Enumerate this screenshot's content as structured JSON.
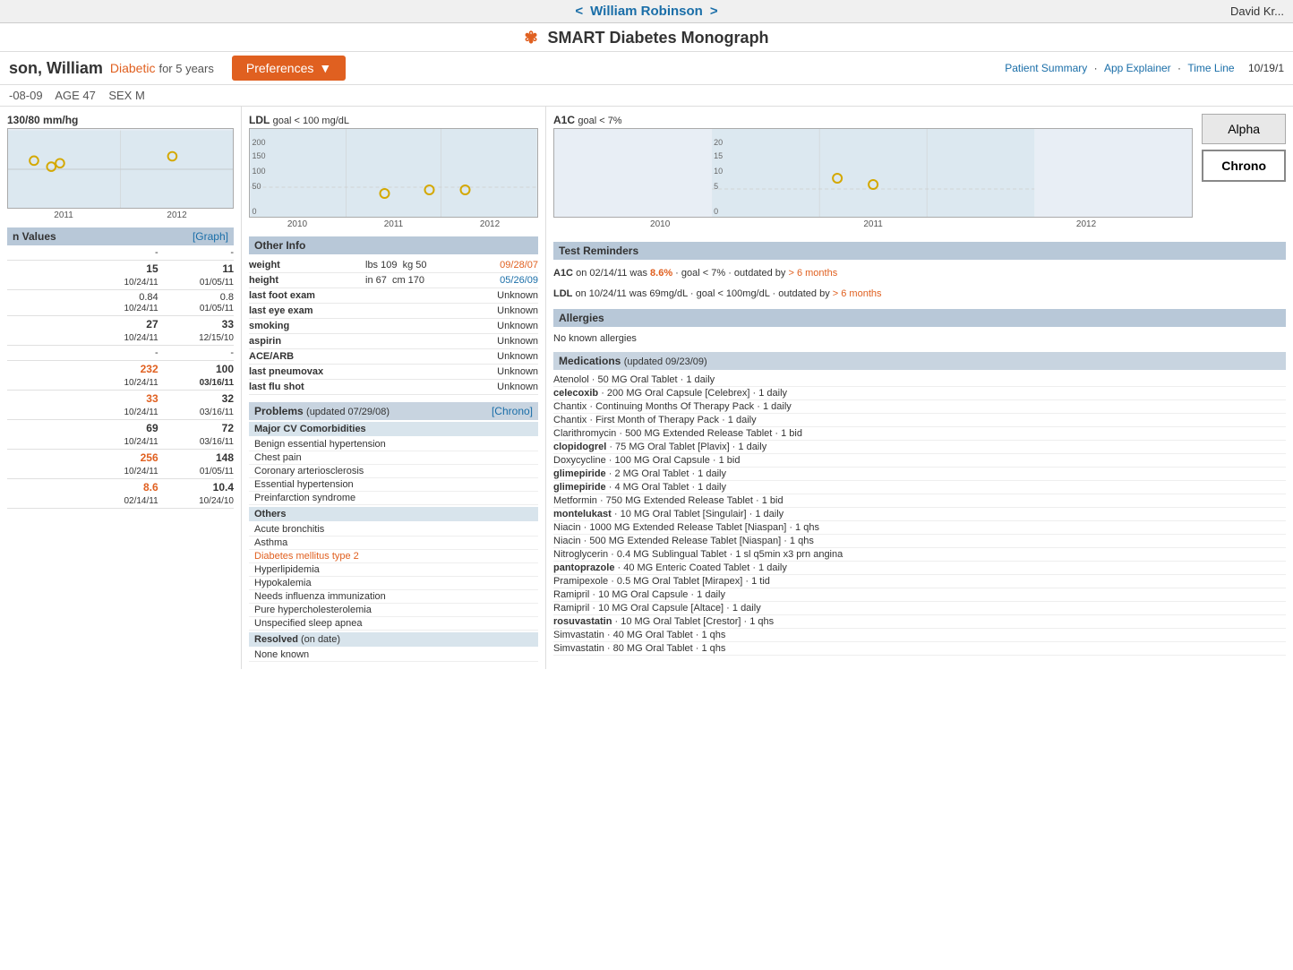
{
  "nav": {
    "prev": "<",
    "next": ">",
    "patient_name": "William Robinson",
    "current_user": "David Kr..."
  },
  "title": "SMART Diabetes Monograph",
  "header": {
    "patient_last": "son, William",
    "diabetic_label": "Diabetic",
    "for_years": "for 5 years",
    "pref_button": "Preferences",
    "patient_summary": "Patient Summary",
    "app_explainer": "App Explainer",
    "time_line": "Time Line",
    "date": "10/19/1"
  },
  "demo": {
    "dob": "-08-09",
    "age_label": "AGE",
    "age": "47",
    "sex_label": "SEX",
    "sex": "M"
  },
  "bp_chart": {
    "title": "130/80 mm/hg",
    "years": [
      "2011",
      "2012"
    ]
  },
  "ldl_chart": {
    "title": "LDL",
    "goal": "goal < 100 mg/dL",
    "y_labels": [
      "200",
      "150",
      "100",
      "50",
      "0"
    ],
    "x_labels": [
      "2010",
      "2011",
      "2012"
    ]
  },
  "a1c_chart": {
    "title": "A1C",
    "goal": "goal < 7%",
    "y_labels": [
      "20",
      "15",
      "10",
      "5",
      "0"
    ],
    "x_labels": [
      "2010",
      "2011",
      "2012"
    ]
  },
  "view_buttons": {
    "alpha": "Alpha",
    "chrono": "Chrono"
  },
  "lab_values": {
    "header": "n Values",
    "graph_link": "[Graph]",
    "rows": [
      {
        "label": "",
        "v1": "-",
        "v2": "-",
        "d1": "",
        "d2": ""
      },
      {
        "label": "",
        "v1": "15",
        "v2": "11",
        "d1": "10/24/11",
        "d2": "01/05/11",
        "bold": true
      },
      {
        "label": "",
        "v1": "0.84",
        "v2": "0.8",
        "d1": "10/24/11",
        "d2": "01/05/11"
      },
      {
        "label": "",
        "v1": "27",
        "v2": "33",
        "d1": "10/24/11",
        "d2": "12/15/10",
        "bold": true
      },
      {
        "label": "",
        "v1": "-",
        "v2": "-",
        "d1": "",
        "d2": ""
      },
      {
        "label": "",
        "v1": "232",
        "v2": "100",
        "d1": "10/24/11",
        "d2": "03/16/11",
        "bold": true,
        "color1": "orange"
      },
      {
        "label": "",
        "v1": "33",
        "v2": "32",
        "d1": "10/24/11",
        "d2": "03/16/11",
        "bold": true,
        "color1": "orange",
        "color2": "orange"
      },
      {
        "label": "",
        "v1": "69",
        "v2": "72",
        "d1": "10/24/11",
        "d2": "03/16/11",
        "bold": true
      },
      {
        "label": "",
        "v1": "256",
        "v2": "148",
        "d1": "10/24/11",
        "d2": "01/05/11",
        "bold": true,
        "color1": "orange",
        "color2": "orange"
      },
      {
        "label": "",
        "v1": "8.6",
        "v2": "10.4",
        "d1": "02/14/11",
        "d2": "10/24/10",
        "bold": true,
        "color1": "orange",
        "color2": "orange"
      }
    ]
  },
  "other_info": {
    "header": "Other Info",
    "rows": [
      {
        "label": "weight",
        "value": "lbs 109  kg 50",
        "date": "09/28/07",
        "date_color": "orange"
      },
      {
        "label": "height",
        "value": "in 67  cm 170",
        "date": "05/26/09",
        "date_color": "blue"
      },
      {
        "label": "last foot exam",
        "value": "",
        "date": "Unknown",
        "date_color": ""
      },
      {
        "label": "last eye exam",
        "value": "",
        "date": "Unknown",
        "date_color": ""
      },
      {
        "label": "smoking",
        "value": "",
        "date": "Unknown",
        "date_color": ""
      },
      {
        "label": "aspirin",
        "value": "",
        "date": "Unknown",
        "date_color": ""
      },
      {
        "label": "ACE/ARB",
        "value": "",
        "date": "Unknown",
        "date_color": ""
      },
      {
        "label": "last pneumovax",
        "value": "",
        "date": "Unknown",
        "date_color": ""
      },
      {
        "label": "last flu shot",
        "value": "",
        "date": "Unknown",
        "date_color": ""
      }
    ]
  },
  "problems": {
    "header": "Problems",
    "updated": "updated 07/29/08",
    "chrono_link": "[Chrono]",
    "major_cv": "Major CV Comorbidities",
    "major_items": [
      "Benign essential hypertension",
      "Chest pain",
      "Coronary arteriosclerosis",
      "Essential hypertension",
      "Preinfarction syndrome"
    ],
    "others_header": "Others",
    "other_items": [
      {
        "text": "Acute bronchitis",
        "highlight": false
      },
      {
        "text": "Asthma",
        "highlight": false
      },
      {
        "text": "Diabetes mellitus type 2",
        "highlight": true
      },
      {
        "text": "Hyperlipidemia",
        "highlight": false
      },
      {
        "text": "Hypokalemia",
        "highlight": false
      },
      {
        "text": "Needs influenza immunization",
        "highlight": false
      },
      {
        "text": "Pure hypercholesterolemia",
        "highlight": false
      },
      {
        "text": "Unspecified sleep apnea",
        "highlight": false
      }
    ],
    "resolved_header": "Resolved",
    "resolved_date": "on date",
    "resolved_items": [
      "None known"
    ]
  },
  "test_reminders": {
    "header": "Test Reminders",
    "a1c_reminder": "A1C on 02/14/11 was",
    "a1c_val": "8.6%",
    "a1c_goal": "· goal < 7% · outdated by",
    "a1c_outdated": "> 6 months",
    "ldl_reminder": "LDL on 10/24/11 was 69mg/dL · goal < 100mg/dL · outdated by",
    "ldl_outdated": "> 6 months"
  },
  "allergies": {
    "header": "Allergies",
    "text": "No known allergies"
  },
  "medications": {
    "header": "Medications",
    "updated": "updated 09/23/09",
    "items": [
      "Atenolol · 50 MG Oral Tablet · 1 daily",
      "celecoxib · 200 MG Oral Capsule [Celebrex] · 1 daily",
      "Chantix · Continuing Months Of Therapy Pack · 1 daily",
      "Chantix · First Month of Therapy Pack · 1 daily",
      "Clarithromycin · 500 MG Extended Release Tablet · 1 bid",
      "clopidogrel · 75 MG Oral Tablet [Plavix] · 1 daily",
      "Doxycycline · 100 MG Oral Capsule · 1 bid",
      "glimepiride · 2 MG Oral Tablet · 1 daily",
      "glimepiride · 4 MG Oral Tablet · 1 daily",
      "Metformin · 750 MG Extended Release Tablet · 1 bid",
      "montelukast · 10 MG Oral Tablet [Singulair] · 1 daily",
      "Niacin · 1000 MG Extended Release Tablet [Niaspan] · 1 qhs",
      "Niacin · 500 MG Extended Release Tablet [Niaspan] · 1 qhs",
      "Nitroglycerin · 0.4 MG Sublingual Tablet · 1 sl q5min x3 prn angina",
      "pantoprazole · 40 MG Enteric Coated Tablet · 1 daily",
      "Pramipexole · 0.5 MG Oral Tablet [Mirapex] · 1 tid",
      "Ramipril · 10 MG Oral Capsule · 1 daily",
      "Ramipril · 10 MG Oral Capsule [Altace] · 1 daily",
      "rosuvastatin · 10 MG Oral Tablet [Crestor] · 1 qhs",
      "Simvastatin · 40 MG Oral Tablet · 1 qhs",
      "Simvastatin · 80 MG Oral Tablet · 1 qhs"
    ]
  }
}
